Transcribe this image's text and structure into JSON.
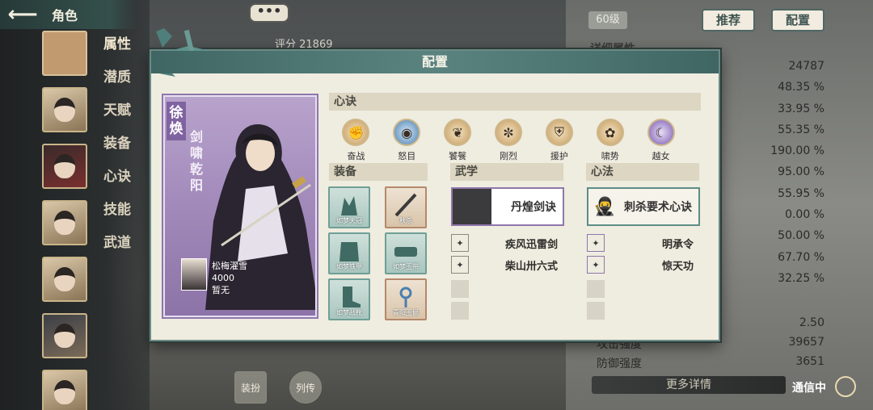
{
  "nav": {
    "back_icon": "arrow-left-icon",
    "title": "角色"
  },
  "side_menu": [
    "属性",
    "潜质",
    "天赋",
    "装备",
    "心诀",
    "技能",
    "武道"
  ],
  "chat_bubble": "•••",
  "score_text": "评分 21869",
  "level_badge": "60级",
  "top_buttons": {
    "recommend": "推荐",
    "config": "配置"
  },
  "detail_title": "详细属性",
  "stat_values": [
    "24787",
    "48.35 %",
    "33.95 %",
    "55.35 %",
    "190.00 %",
    "95.00 %",
    "55.95 %",
    "0.00 %",
    "50.00 %",
    "67.70 %",
    "32.25 %"
  ],
  "stat_rows": [
    {
      "label": "",
      "value": "2.50"
    },
    {
      "label": "攻击强度",
      "value": "39657"
    },
    {
      "label": "防御强度",
      "value": "3651"
    }
  ],
  "more_details": "更多详情",
  "comm_status": "通信中",
  "bottom_buttons": [
    "装扮",
    "列传"
  ],
  "modal": {
    "title": "配置",
    "character": {
      "name": "徐焕",
      "title": "剑啸乾阳",
      "skin_name": "松梅濯雪",
      "skin_value": "4000",
      "skin_status": "暂无"
    },
    "xinjue": {
      "header": "心诀",
      "items": [
        {
          "label": "奋战",
          "icon": "fist-icon",
          "color": "#c49a5e"
        },
        {
          "label": "怒目",
          "icon": "eye-icon",
          "color": "#4a7fb0"
        },
        {
          "label": "饕餮",
          "icon": "beast-icon",
          "color": "#c49a5e"
        },
        {
          "label": "刚烈",
          "icon": "flame-icon",
          "color": "#c49a5e"
        },
        {
          "label": "援护",
          "icon": "shield-icon",
          "color": "#c49a5e"
        },
        {
          "label": "啸势",
          "icon": "roar-icon",
          "color": "#c49a5e"
        },
        {
          "label": "越女",
          "icon": "moon-icon",
          "color": "#7a5ab0"
        }
      ]
    },
    "equipment": {
      "header": "装备",
      "items": [
        {
          "label": "如梦天冠",
          "icon": "crown-icon"
        },
        {
          "label": "秋杀",
          "icon": "sword-icon"
        },
        {
          "label": "如梦铁甲",
          "icon": "armor-icon"
        },
        {
          "label": "如梦玉带",
          "icon": "belt-icon"
        },
        {
          "label": "如梦战靴",
          "icon": "boots-icon"
        },
        {
          "label": "青阳玉佩",
          "icon": "pendant-icon"
        }
      ]
    },
    "wuxue": {
      "header": "武学",
      "main": "丹煌剑诀",
      "subs": [
        "疾风迅雷剑",
        "柴山卅六式"
      ]
    },
    "xinfa": {
      "header": "心法",
      "main": "刺杀要术心诀",
      "subs": [
        "明承令",
        "惊天功"
      ]
    }
  }
}
